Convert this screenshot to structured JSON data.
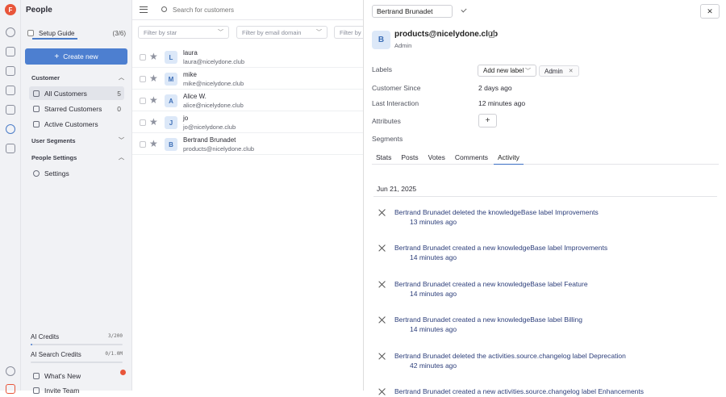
{
  "app": {
    "title": "People"
  },
  "sidebar": {
    "guide_label": "Setup Guide",
    "guide_count": "(3/6)",
    "create_label": "Create new",
    "customer_section": "Customer",
    "items": [
      {
        "label": "All Customers",
        "count": "5"
      },
      {
        "label": "Starred Customers",
        "count": "0"
      },
      {
        "label": "Active Customers",
        "count": ""
      }
    ],
    "user_segments": "User Segments",
    "people_settings": "People Settings",
    "settings_label": "Settings",
    "ai_credits_label": "AI Credits",
    "ai_credits_value": "3/200",
    "ai_credits_fraction": 0.015,
    "ai_search_label": "AI Search Credits",
    "ai_search_value": "0/1.0M",
    "ai_search_fraction": 0.0,
    "whats_new": "What's New",
    "invite_team": "Invite Team"
  },
  "main": {
    "search_placeholder": "Search for customers",
    "filters": [
      "Filter by star",
      "Filter by email domain",
      "Filter by c"
    ],
    "rows": [
      {
        "initial": "L",
        "name": "laura",
        "email": "laura@nicelydone.club"
      },
      {
        "initial": "M",
        "name": "mike",
        "email": "mike@nicelydone.club"
      },
      {
        "initial": "A",
        "name": "Alice W.",
        "email": "alice@nicelydone.club"
      },
      {
        "initial": "J",
        "name": "jo",
        "email": "jo@nicelydone.club"
      },
      {
        "initial": "B",
        "name": "Bertrand Brunadet",
        "email": "products@nicelydone.club"
      }
    ]
  },
  "panel": {
    "name_value": "Bertrand Brunadet",
    "initial": "B",
    "org": "products@nicelydone.club",
    "role": "Admin",
    "labels_label": "Labels",
    "add_label_btn": "Add new label",
    "tag": "Admin",
    "customer_since_label": "Customer Since",
    "customer_since_value": "2 days ago",
    "last_interaction_label": "Last Interaction",
    "last_interaction_value": "12 minutes ago",
    "attributes_label": "Attributes",
    "segments_label": "Segments",
    "tabs": [
      "Stats",
      "Posts",
      "Votes",
      "Comments",
      "Activity"
    ],
    "date": "Jun 21, 2025",
    "activities": [
      {
        "text": "Bertrand Brunadet deleted the knowledgeBase label Improvements",
        "time": "13 minutes ago"
      },
      {
        "text": "Bertrand Brunadet created a new knowledgeBase label Improvements",
        "time": "14 minutes ago"
      },
      {
        "text": "Bertrand Brunadet created a new knowledgeBase label Feature",
        "time": "14 minutes ago"
      },
      {
        "text": "Bertrand Brunadet created a new knowledgeBase label Billing",
        "time": "14 minutes ago"
      },
      {
        "text": "Bertrand Brunadet deleted the activities.source.changelog label Deprecation",
        "time": "42 minutes ago"
      },
      {
        "text": "Bertrand Brunadet created a new activities.source.changelog label Enhancements",
        "time": ""
      }
    ]
  }
}
